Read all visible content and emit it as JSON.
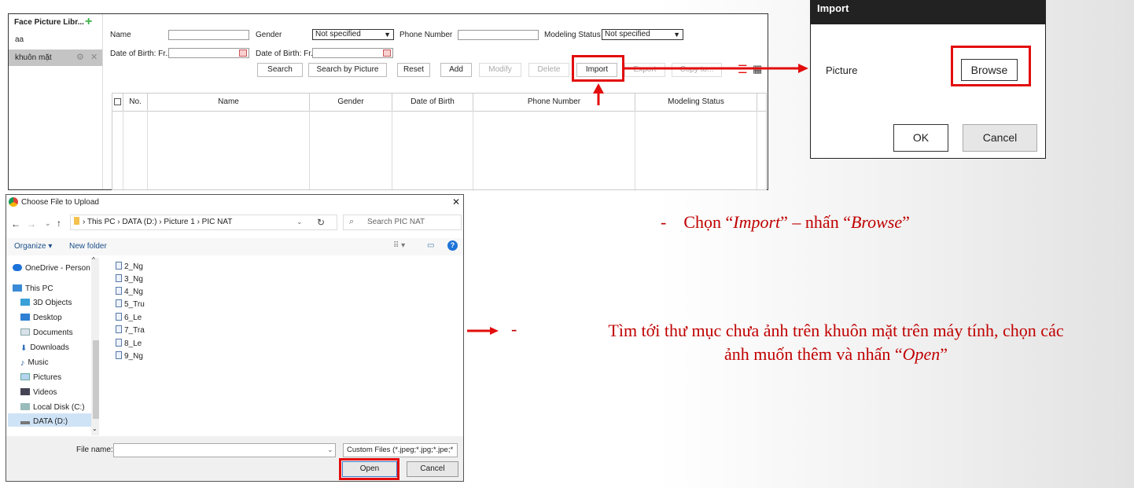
{
  "face_library": {
    "panel_title": "Face Picture Libr...",
    "items": [
      "aa",
      "khuôn mặt"
    ],
    "filters": {
      "name_label": "Name",
      "gender_label": "Gender",
      "gender_value": "Not specified",
      "phone_label": "Phone Number",
      "modeling_label": "Modeling Status",
      "modeling_value": "Not specified",
      "dob_from_label": "Date of Birth: Fr...",
      "dob_to_label": "Date of Birth: Fr..."
    },
    "buttons": {
      "search": "Search",
      "search_by_picture": "Search by Picture",
      "reset": "Reset",
      "add": "Add",
      "modify": "Modify",
      "delete": "Delete",
      "import": "Import",
      "export": "Export",
      "copy_to": "Copy to..."
    },
    "table_headers": [
      "No.",
      "Name",
      "Gender",
      "Date of Birth",
      "Phone Number",
      "Modeling Status"
    ]
  },
  "import_dialog": {
    "title": "Import",
    "picture_label": "Picture",
    "browse": "Browse",
    "ok": "OK",
    "cancel": "Cancel"
  },
  "file_dialog": {
    "title": "Choose File to Upload",
    "breadcrumb": "›  This PC  ›  DATA (D:)  ›  Picture 1  ›  PIC NAT",
    "search_placeholder": "Search PIC NAT",
    "organize": "Organize ▾",
    "new_folder": "New folder",
    "tree": [
      "OneDrive - Person",
      "This PC",
      "3D Objects",
      "Desktop",
      "Documents",
      "Downloads",
      "Music",
      "Pictures",
      "Videos",
      "Local Disk (C:)",
      "DATA (D:)"
    ],
    "files": [
      "2_Ng",
      "3_Ng",
      "4_Ng",
      "5_Tru",
      "6_Le",
      "7_Tra",
      "8_Le",
      "9_Ng"
    ],
    "file_name_label": "File name:",
    "filter_value": "Custom Files (*.jpeg;*.jpg;*.jpe;*",
    "open": "Open",
    "cancel": "Cancel"
  },
  "notes": {
    "note1": {
      "dash": "-",
      "pre": "Chọn “",
      "em1": "Import",
      "mid": "” – nhấn “",
      "em2": "Browse",
      "post": "”"
    },
    "note2": {
      "dash": "-",
      "line1": "Tìm tới thư mục chưa ảnh trên khuôn mặt trên máy tính, chọn các",
      "line2_pre": "ảnh muốn thêm và nhấn “",
      "em": "Open",
      "line2_post": "”"
    }
  },
  "colors": {
    "highlight": "#e30d0d",
    "note_text": "#c00000",
    "dialog_header": "#222222"
  }
}
